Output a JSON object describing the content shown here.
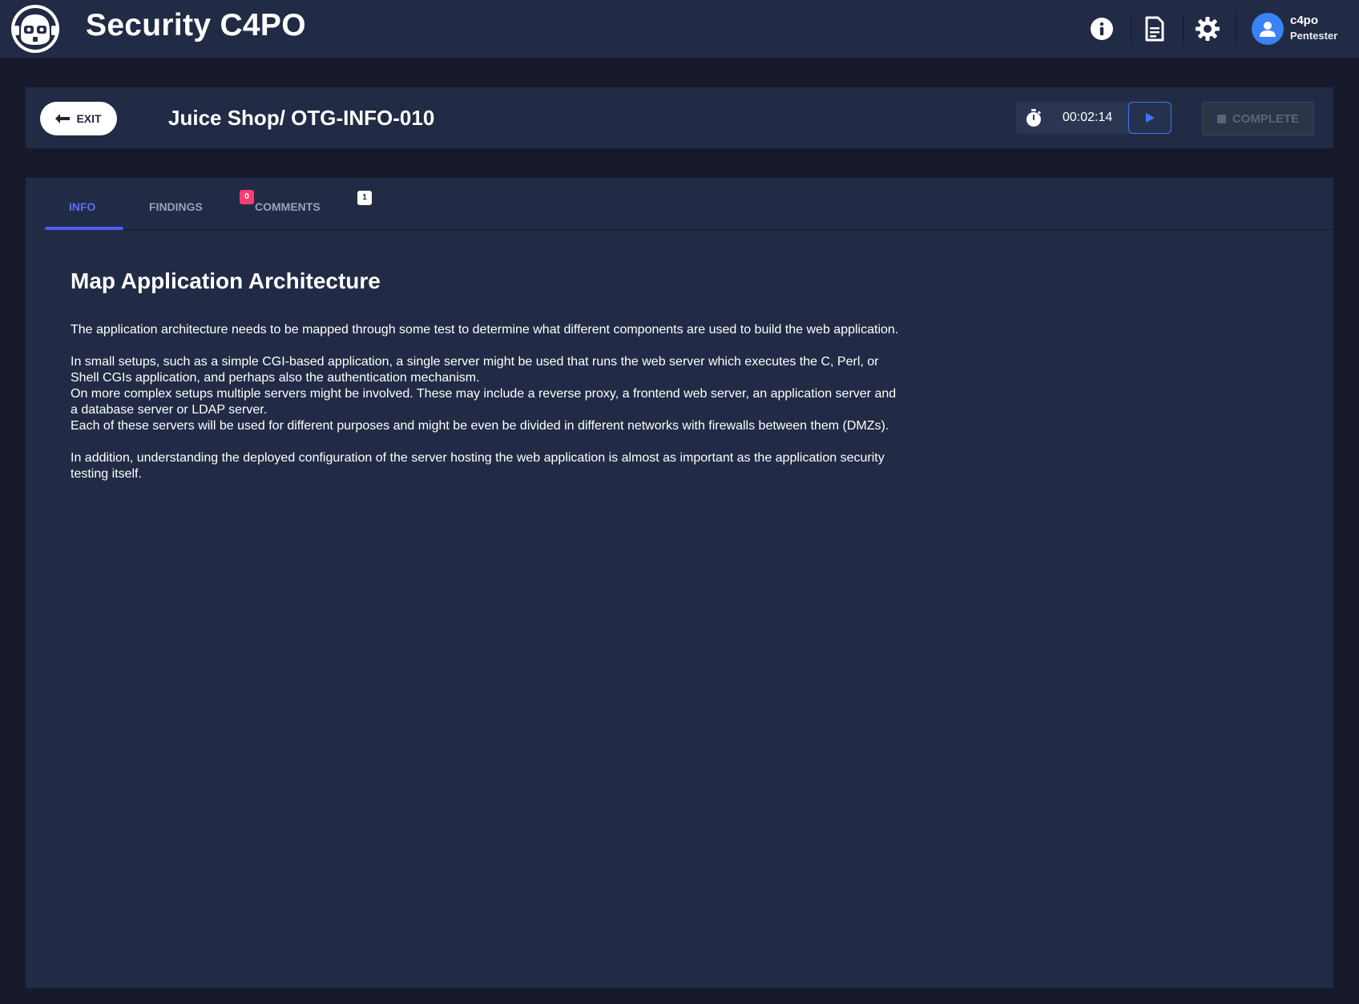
{
  "app": {
    "title": "Security C4PO"
  },
  "user": {
    "name": "c4po",
    "role": "Pentester"
  },
  "toolbar_icons": [
    "info-icon",
    "report-icon",
    "settings-icon",
    "user-icon"
  ],
  "header": {
    "exit_label": "EXIT",
    "title": "Juice Shop/ OTG-INFO-010",
    "timer": "00:02:14",
    "complete_label": "COMPLETE"
  },
  "tabs": [
    {
      "label": "INFO",
      "active": true
    },
    {
      "label": "FINDINGS",
      "badge": "0"
    },
    {
      "label": "COMMENTS",
      "badge": "1"
    }
  ],
  "info": {
    "heading": "Map Application Architecture",
    "paragraphs": [
      "The application architecture needs to be mapped through some test to determine what different components are used to build the web application.",
      "In small setups, such as a simple CGI-based application, a single server might be used that runs the web server which executes the C, Perl, or Shell CGIs application, and perhaps also the authentication mechanism.",
      "On more complex setups multiple servers might be involved. These may include a reverse proxy, a frontend web server, an application server and a database server or LDAP server.",
      "Each of these servers will be used for different purposes and might be even be divided in different networks with firewalls between them (DMZs).",
      "In addition, understanding the deployed configuration of the server hosting the web application is almost as important as the application security testing itself."
    ]
  },
  "colors": {
    "background": "#161a2b",
    "card": "#222b45",
    "accent": "#4a5cf0",
    "play_accent": "#3d77f0",
    "badge_red": "#ff3d71"
  }
}
